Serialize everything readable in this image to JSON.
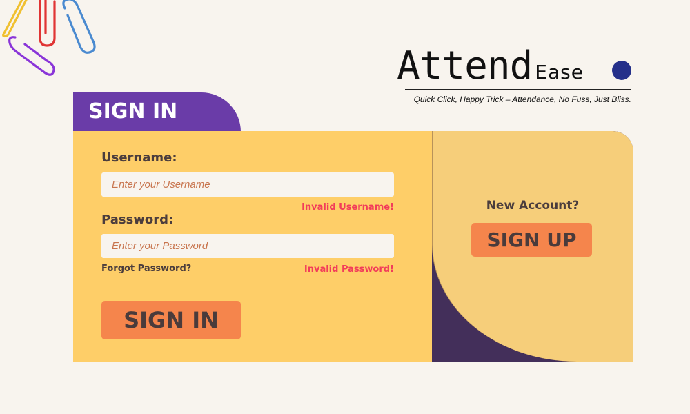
{
  "brand": {
    "name_main": "Attend",
    "name_sub": "Ease",
    "tagline": "Quick Click, Happy Trick – Attendance, No Fuss, Just Bliss."
  },
  "signin": {
    "tab_label": "SIGN IN",
    "username_label": "Username:",
    "username_placeholder": "Enter your Username",
    "username_value": "",
    "username_error": "Invalid Username!",
    "password_label": "Password:",
    "password_placeholder": "Enter your Password",
    "password_value": "",
    "password_error": "Invalid Password!",
    "forgot_label": "Forgot Password?",
    "submit_label": "SIGN IN"
  },
  "signup": {
    "prompt": "New Account?",
    "button_label": "SIGN UP"
  },
  "colors": {
    "background": "#f8f4ee",
    "tab": "#6a3ca8",
    "card_left": "#fece68",
    "card_right": "#f6ce7a",
    "card_corner": "#432f5a",
    "button": "#f5854c",
    "error": "#f23c5a",
    "brand_dot": "#25308a"
  },
  "decorations": {
    "paperclip_colors": [
      "#f0c030",
      "#e03535",
      "#4a8ad0",
      "#8a35d8"
    ]
  }
}
